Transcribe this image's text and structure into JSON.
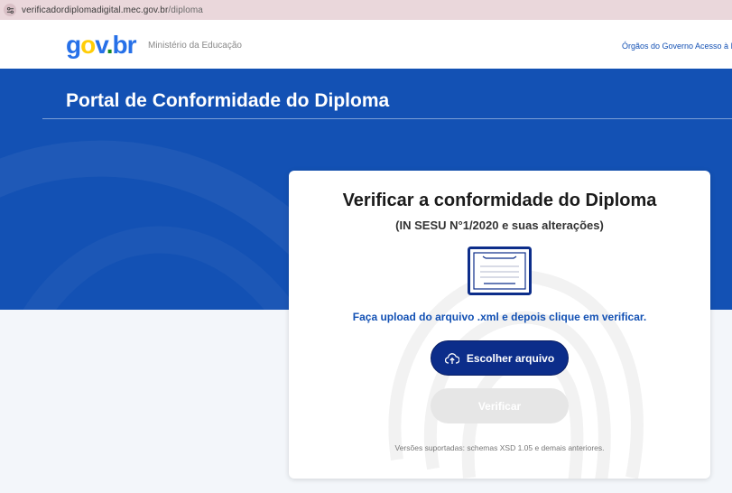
{
  "browser": {
    "url_host": "verificadordiplomadigital.mec.gov.br",
    "url_path": "/diploma"
  },
  "header": {
    "logo": {
      "g": "g",
      "o1": "o",
      "v": "v",
      "dot": ".",
      "b": "b",
      "r": "r"
    },
    "ministry": "Ministério da Educação",
    "nav": [
      {
        "label": "Órgãos do Governo"
      },
      {
        "label": "Acesso à In"
      }
    ]
  },
  "hero": {
    "title": "Portal de Conformidade do Diploma"
  },
  "card": {
    "title": "Verificar a conformidade do Diploma",
    "subtitle": "(IN SESU N°1/2020 e suas alterações)",
    "instruction": "Faça upload do arquivo .xml e depois clique em verificar.",
    "choose_button": "Escolher arquivo",
    "verify_button": "Verificar",
    "versions_note": "Versões suportadas: schemas XSD 1.05 e demais anteriores."
  },
  "colors": {
    "brand_blue": "#1351b4",
    "dark_blue": "#0c2d8a",
    "disabled": "#e6e6e6"
  },
  "icons": [
    "site-settings-icon",
    "diploma-icon",
    "upload-cloud-icon"
  ]
}
